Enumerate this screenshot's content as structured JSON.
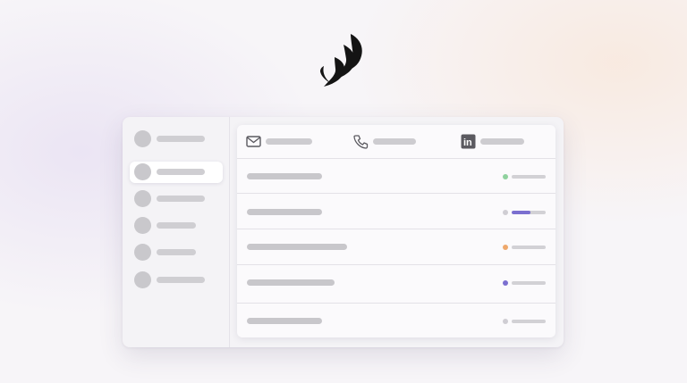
{
  "logo": {
    "icon": "flame-logo-icon",
    "color": "#141414"
  },
  "sidebar": {
    "items": [
      {
        "icon": "avatar-placeholder",
        "active": false
      },
      {
        "icon": "avatar-placeholder",
        "active": true
      },
      {
        "icon": "avatar-placeholder",
        "active": false
      },
      {
        "icon": "avatar-placeholder",
        "active": false
      },
      {
        "icon": "avatar-placeholder",
        "active": false
      },
      {
        "icon": "avatar-placeholder",
        "active": false
      }
    ]
  },
  "table": {
    "columns": [
      {
        "icon": "mail-icon"
      },
      {
        "icon": "phone-icon"
      },
      {
        "icon": "linkedin-icon",
        "label": "in"
      }
    ],
    "rows": [
      {
        "status_color": "#8fd19e",
        "progress": 0
      },
      {
        "status_color": "#cfcdd3",
        "progress": 0.55,
        "fill_color": "#7b6fd0"
      },
      {
        "status_color": "#eea86c",
        "progress": 0
      },
      {
        "status_color": "#7b6fd0",
        "progress": 0
      },
      {
        "status_color": "#cfcdd3",
        "progress": 0
      }
    ]
  }
}
